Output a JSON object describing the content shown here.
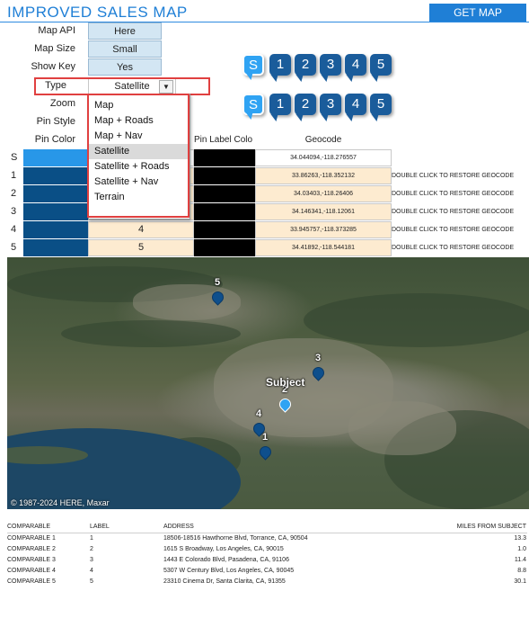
{
  "header": {
    "title": "IMPROVED SALES MAP",
    "get_map_label": "GET MAP"
  },
  "settings": [
    {
      "label": "Map API",
      "value": "Here"
    },
    {
      "label": "Map Size",
      "value": "Small"
    },
    {
      "label": "Show Key",
      "value": "Yes"
    },
    {
      "label": "Type",
      "value": "Satellite"
    },
    {
      "label": "Zoom",
      "value": ""
    },
    {
      "label": "Pin Style",
      "value": ""
    },
    {
      "label": "Pin Color",
      "value": ""
    }
  ],
  "pin_rows": [
    [
      "S",
      "1",
      "2",
      "3",
      "4",
      "5"
    ],
    [
      "S",
      "1",
      "2",
      "3",
      "4",
      "5"
    ]
  ],
  "dropdown": {
    "options": [
      "Map",
      "Map + Roads",
      "Map + Nav",
      "Satellite",
      "Satellite + Roads",
      "Satellite + Nav",
      "Terrain"
    ],
    "selected": "Satellite"
  },
  "table": {
    "headers": {
      "pin_label_color": "Pin Label Colo",
      "geocode": "Geocode"
    },
    "rows": [
      {
        "id": "S",
        "label": "",
        "geocode": "34.044094,-118.276557",
        "note": ""
      },
      {
        "id": "1",
        "label": "",
        "geocode": "33.86263,-118.352132",
        "note": "DOUBLE CLICK TO RESTORE GEOCODE"
      },
      {
        "id": "2",
        "label": "",
        "geocode": "34.03403,-118.26406",
        "note": "DOUBLE CLICK TO RESTORE GEOCODE"
      },
      {
        "id": "3",
        "label": "",
        "geocode": "34.146341,-118.12061",
        "note": "DOUBLE CLICK TO RESTORE GEOCODE"
      },
      {
        "id": "4",
        "label": "4",
        "geocode": "33.945757,-118.373285",
        "note": "DOUBLE CLICK TO RESTORE GEOCODE"
      },
      {
        "id": "5",
        "label": "5",
        "geocode": "34.41892,-118.544181",
        "note": "DOUBLE CLICK TO RESTORE GEOCODE"
      }
    ]
  },
  "map": {
    "subject_label": "Subject",
    "pins": [
      "5",
      "3",
      "2",
      "4",
      "1"
    ],
    "copyright": "© 1987-2024 HERE, Maxar"
  },
  "comparables": {
    "headers": [
      "COMPARABLE",
      "LABEL",
      "ADDRESS",
      "MILES FROM SUBJECT"
    ],
    "rows": [
      [
        "COMPARABLE 1",
        "1",
        "18506-18516 Hawthorne Blvd, Torrance, CA, 90504",
        "13.3"
      ],
      [
        "COMPARABLE 2",
        "2",
        "1615 S Broadway, Los Angeles, CA, 90015",
        "1.0"
      ],
      [
        "COMPARABLE 3",
        "3",
        "1443 E Colorado Blvd, Pasadena, CA, 91106",
        "11.4"
      ],
      [
        "COMPARABLE 4",
        "4",
        "5307 W Century Blvd, Los Angeles, CA, 90045",
        "8.8"
      ],
      [
        "COMPARABLE 5",
        "5",
        "23310 Cinema Dr, Santa Clarita, CA, 91355",
        "30.1"
      ]
    ]
  },
  "colors": {
    "accent": "#1f7fd6",
    "pin_blue": "#0a4f86",
    "subject_blue": "#2fa3f3",
    "highlight_red": "#e04040",
    "cell_cream": "#fdebd0",
    "cell_blue": "#d3e6f3"
  }
}
